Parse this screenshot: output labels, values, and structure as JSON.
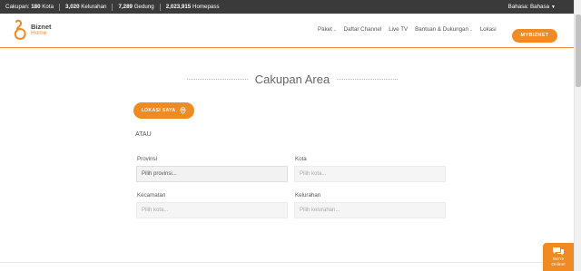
{
  "topbar": {
    "stats": [
      {
        "label": "Cakupan:",
        "value": "180",
        "unit": "Kota"
      },
      {
        "label": "",
        "value": "3,020",
        "unit": "Kelurahan"
      },
      {
        "label": "",
        "value": "7,289",
        "unit": "Gedung"
      },
      {
        "label": "",
        "value": "2,023,915",
        "unit": "Homepass"
      }
    ],
    "language": "Bahasa: Bahasa"
  },
  "logo": {
    "line1": "Biznet",
    "line2": "Home"
  },
  "nav": {
    "items": [
      {
        "label": "Paket",
        "dropdown": true
      },
      {
        "label": "Daftar Channel",
        "dropdown": false
      },
      {
        "label": "Live TV",
        "dropdown": false
      },
      {
        "label": "Bantuan & Dukungan",
        "dropdown": true
      },
      {
        "label": "Lokasi",
        "dropdown": false
      }
    ],
    "cta": "MYBIZNET"
  },
  "main": {
    "title": "Cakupan Area",
    "location_button": "LOKASI SAYA",
    "or_text": "ATAU",
    "form": {
      "provinsi": {
        "label": "Provinsi",
        "value": "Pilih provinsi..."
      },
      "kota": {
        "label": "Kota",
        "placeholder": "Pilih kota..."
      },
      "kecamatan": {
        "label": "Kecamatan",
        "placeholder": "Pilih kota..."
      },
      "kelurahan": {
        "label": "Kelurahan",
        "placeholder": "Pilih kelurahan..."
      }
    }
  },
  "chat": {
    "line1": "We're",
    "line2": "Online!"
  },
  "colors": {
    "accent": "#f08a22",
    "topbar": "#3a3a3a"
  }
}
